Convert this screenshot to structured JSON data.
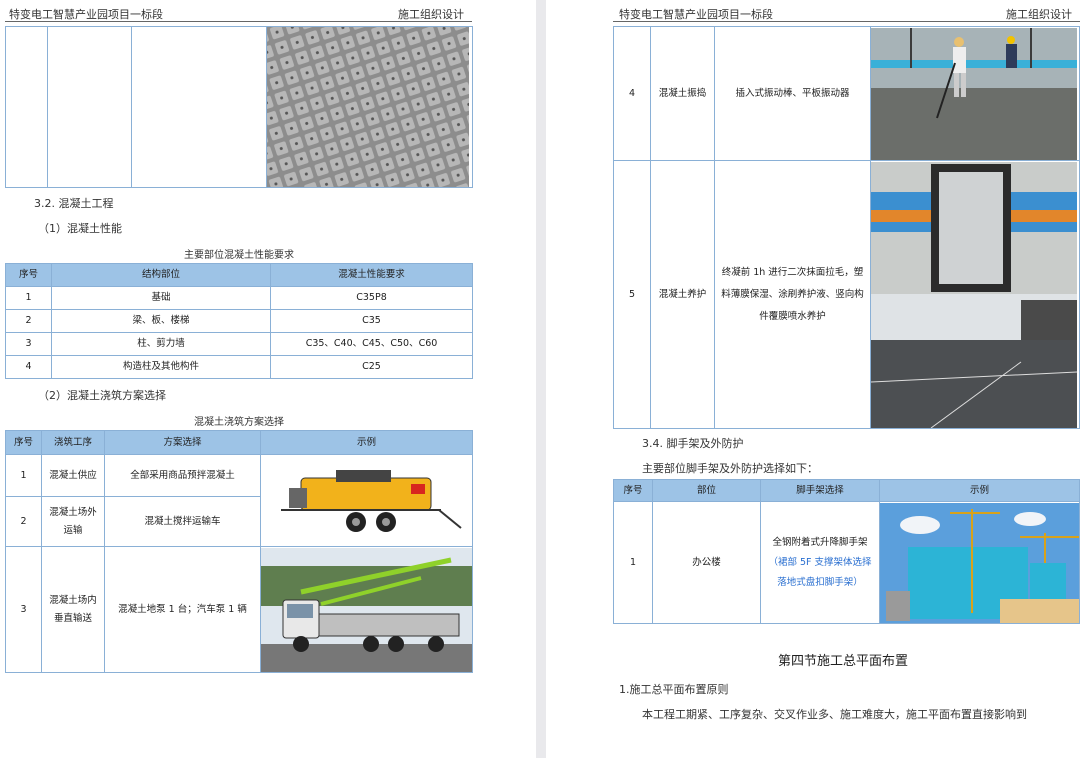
{
  "header": {
    "left": "特变电工智慧产业园项目一标段",
    "right": "施工组织设计"
  },
  "left": {
    "section_32": "3.2. 混凝土工程",
    "sub1": "（1）混凝土性能",
    "table1": {
      "caption": "主要部位混凝土性能要求",
      "headers": [
        "序号",
        "结构部位",
        "混凝土性能要求"
      ],
      "rows": [
        [
          "1",
          "基础",
          "C35P8"
        ],
        [
          "2",
          "梁、板、楼梯",
          "C35"
        ],
        [
          "3",
          "柱、剪力墙",
          "C35、C40、C45、C50、C60"
        ],
        [
          "4",
          "构造柱及其他构件",
          "C25"
        ]
      ]
    },
    "sub2": "（2）混凝土浇筑方案选择",
    "table2": {
      "caption": "混凝土浇筑方案选择",
      "headers": [
        "序号",
        "浇筑工序",
        "方案选择",
        "示例"
      ],
      "rows": [
        [
          "1",
          "混凝土供应",
          "全部采用商品预拌混凝土"
        ],
        [
          "2",
          "混凝土场外运输",
          "混凝土搅拌运输车"
        ],
        [
          "3",
          "混凝土场内垂直输送",
          "混凝土地泵 1 台；汽车泵 1 辆"
        ]
      ]
    }
  },
  "right": {
    "table_top": {
      "rows": [
        [
          "4",
          "混凝土振捣",
          "插入式振动棒、平板振动器"
        ],
        [
          "5",
          "混凝土养护",
          "终凝前 1h 进行二次抹面拉毛，塑料薄膜保湿、涂刷养护液、竖向构件覆膜喷水养护"
        ]
      ]
    },
    "section_34": "3.4. 脚手架及外防护",
    "intro_34": "主要部位脚手架及外防护选择如下：",
    "table3": {
      "headers": [
        "序号",
        "部位",
        "脚手架选择",
        "示例"
      ],
      "rows": [
        [
          "1",
          "办公楼",
          "全钢附着式升降脚手架",
          "（裙部 5F 支撑架体选择落地式盘扣脚手架）"
        ]
      ]
    },
    "chapter_title": "第四节施工总平面布置",
    "point1": "1.施工总平面布置原则",
    "para1": "本工程工期紧、工序复杂、交叉作业多、施工难度大，施工平面布置直接影响到"
  },
  "colors": {
    "table_header": "#9dc3e6",
    "table_border": "#8ab0d6",
    "note_blue": "#2a6fd0"
  }
}
